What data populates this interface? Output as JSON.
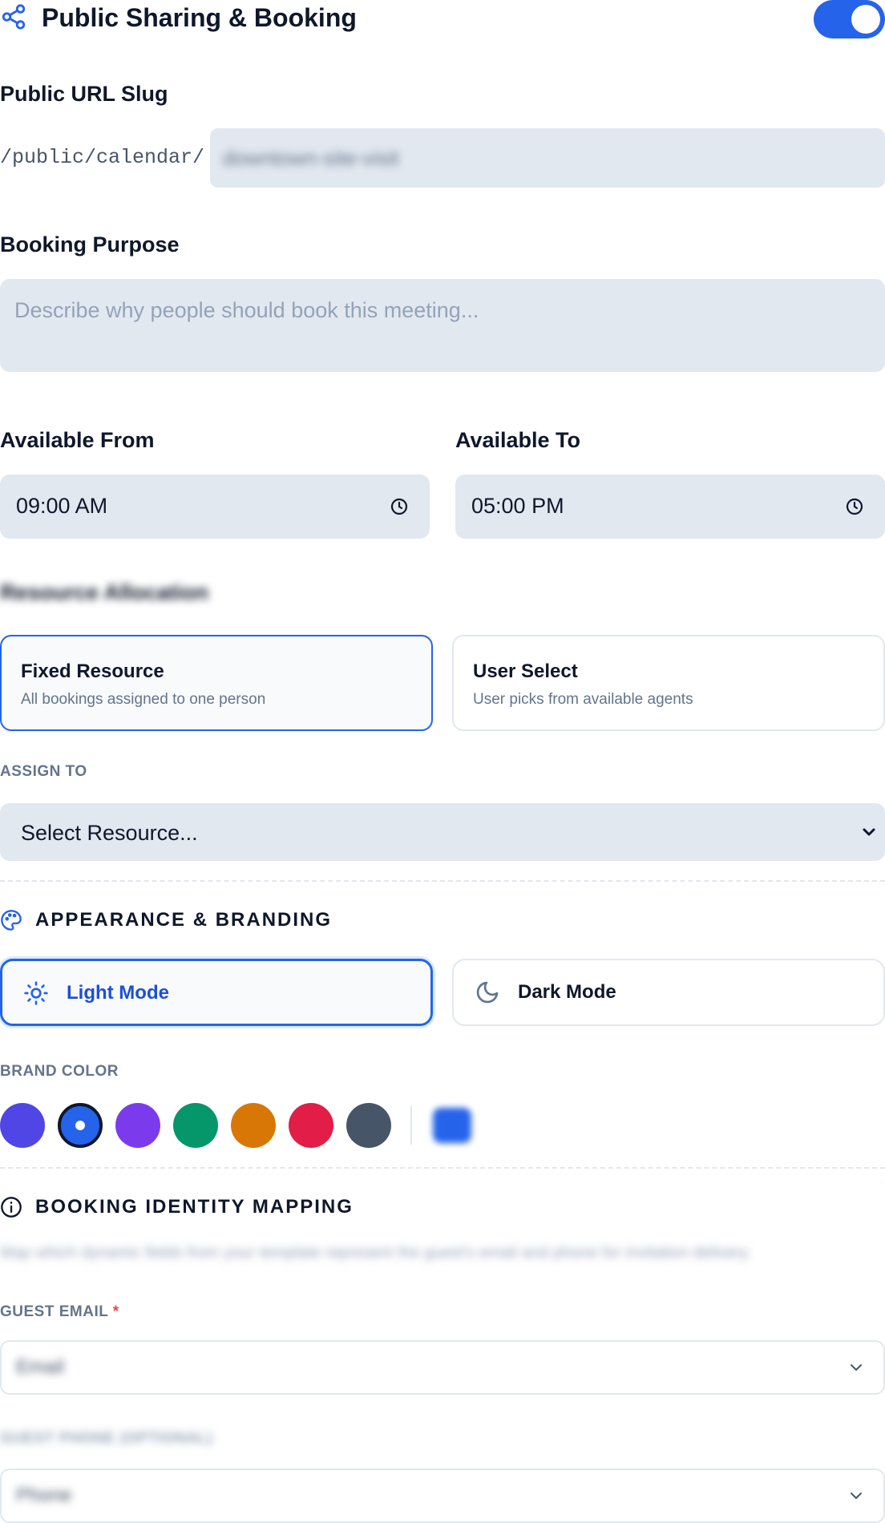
{
  "header": {
    "title": "Public Sharing & Booking",
    "share_icon": "share-icon",
    "toggle_on": true
  },
  "slug": {
    "label": "Public URL Slug",
    "prefix": "/public/calendar/",
    "value": "downtown-site-visit"
  },
  "purpose": {
    "label": "Booking Purpose",
    "placeholder": "Describe why people should book this meeting..."
  },
  "availability": {
    "from_label": "Available From",
    "from_value": "09:00 AM",
    "to_label": "Available To",
    "to_value": "05:00 PM"
  },
  "resource": {
    "label": "Resource Allocation",
    "options": [
      {
        "title": "Fixed Resource",
        "desc": "All bookings assigned to one person",
        "selected": true
      },
      {
        "title": "User Select",
        "desc": "User picks from available agents",
        "selected": false
      }
    ],
    "assign_label": "ASSIGN TO",
    "assign_value": "Select Resource..."
  },
  "appearance": {
    "title": "APPEARANCE & BRANDING",
    "modes": [
      {
        "label": "Light Mode",
        "icon": "sun-icon",
        "selected": true
      },
      {
        "label": "Dark Mode",
        "icon": "moon-icon",
        "selected": false
      }
    ],
    "brand_label": "BRAND COLOR",
    "colors": [
      "#4f46e5",
      "#2563eb",
      "#7c3aed",
      "#059669",
      "#d97706",
      "#e11d48",
      "#475569"
    ],
    "selected_color": "#2563eb",
    "custom_color": "#2563eb"
  },
  "identity": {
    "title": "BOOKING IDENTITY MAPPING",
    "note": "Map which dynamic fields from your template represent the guest's email and phone for invitation delivery.",
    "email_label": "GUEST EMAIL",
    "email_required": "*",
    "email_value": "Email",
    "phone_label": "GUEST PHONE (OPTIONAL)",
    "phone_value": "Phone"
  }
}
